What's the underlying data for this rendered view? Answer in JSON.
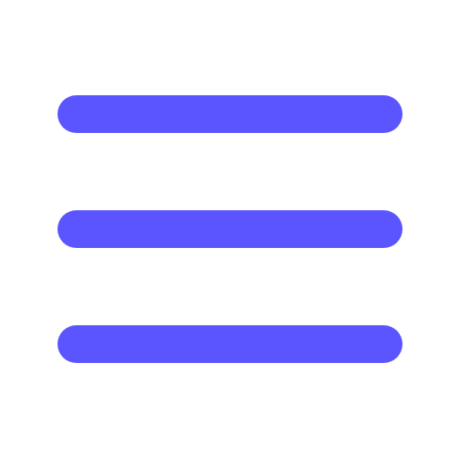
{
  "icon": {
    "name": "hamburger-menu-icon",
    "bar_count": 3
  },
  "colors": {
    "background": "#ffffff",
    "accent": "#5a55ff"
  }
}
